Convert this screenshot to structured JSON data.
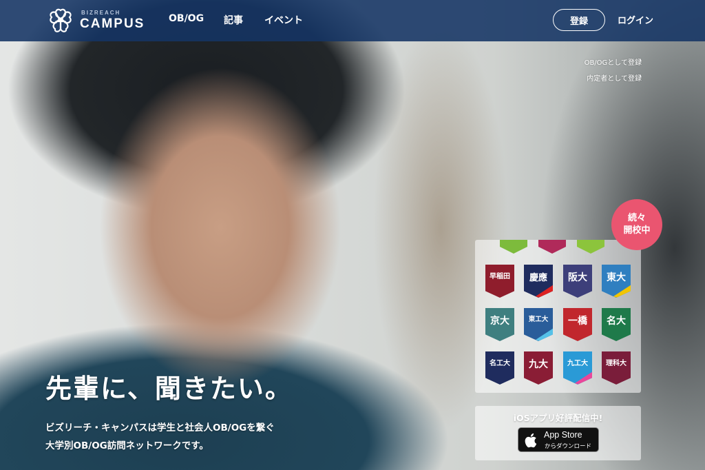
{
  "header": {
    "logo_small": "BIZREACH",
    "logo_main": "CAMPUS",
    "nav": [
      {
        "label": "OB/OG"
      },
      {
        "label": "記事"
      },
      {
        "label": "イベント"
      }
    ],
    "register_label": "登録",
    "login_label": "ログイン",
    "background_color": "#143464"
  },
  "sub_links": [
    {
      "label": "OB/OGとして登録"
    },
    {
      "label": "内定者として登録"
    }
  ],
  "universities": {
    "badge_line1": "続々",
    "badge_line2": "開校中",
    "badge_color": "#ea5570",
    "top_flag_colors": [
      "#7dbb3c",
      "#b02a5a",
      "#8cc43c"
    ],
    "flags": [
      {
        "label": "早稲田",
        "color": "#8f1d2c",
        "accent": ""
      },
      {
        "label": "慶應",
        "color": "#1f2c5e",
        "accent": "#d22"
      },
      {
        "label": "阪大",
        "color": "#3d3f7a",
        "accent": ""
      },
      {
        "label": "東大",
        "color": "#2f7fc0",
        "accent": "#f2c500"
      },
      {
        "label": "京大",
        "color": "#3f7f80",
        "accent": ""
      },
      {
        "label": "東工大",
        "color": "#2a5d9a",
        "accent": "#56c1e8"
      },
      {
        "label": "一橋",
        "color": "#c1272d",
        "accent": ""
      },
      {
        "label": "名大",
        "color": "#1f7a4a",
        "accent": ""
      },
      {
        "label": "名工大",
        "color": "#1f2c5e",
        "accent": ""
      },
      {
        "label": "九大",
        "color": "#8a1d35",
        "accent": ""
      },
      {
        "label": "九工大",
        "color": "#2a9ad6",
        "accent": "#e9479a"
      },
      {
        "label": "理科大",
        "color": "#7a1d3a",
        "accent": ""
      }
    ]
  },
  "hero": {
    "headline": "先輩に、聞きたい。",
    "description_line1": "ビズリーチ・キャンパスは学生と社会人OB/OGを繋ぐ",
    "description_line2": "大学別OB/OG訪問ネットワークです。"
  },
  "app": {
    "text": "iOSアプリ好評配信中!",
    "store_line1": "App Store",
    "store_line2": "からダウンロード"
  }
}
